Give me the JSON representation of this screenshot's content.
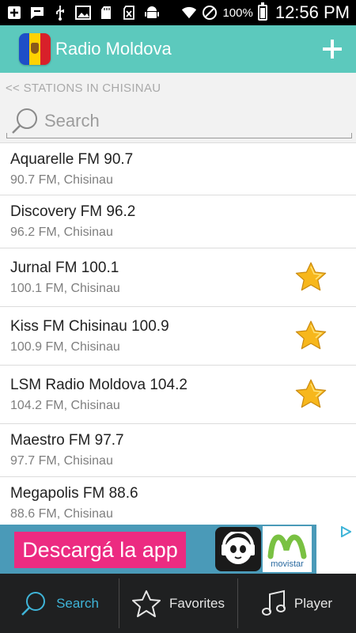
{
  "status_bar": {
    "battery_pct": "100%",
    "time": "12:56 PM",
    "icons": [
      "add-box-icon",
      "chat-icon",
      "usb-icon",
      "image-icon",
      "sd-card-icon",
      "no-sim-icon",
      "android-icon",
      "wifi-icon",
      "do-not-disturb-icon",
      "battery-icon"
    ]
  },
  "app_bar": {
    "title": "Radio Moldova",
    "flag": "moldova-flag-icon",
    "add_icon": "plus-icon",
    "color": "#5cc9bd"
  },
  "breadcrumb": "<< STATIONS IN CHISINAU",
  "search": {
    "placeholder": "Search"
  },
  "stations": [
    {
      "name": "Aquarelle FM 90.7",
      "sub": "90.7 FM, Chisinau",
      "favorite": false
    },
    {
      "name": "Discovery FM 96.2",
      "sub": "96.2 FM, Chisinau",
      "favorite": false
    },
    {
      "name": "Jurnal FM 100.1",
      "sub": "100.1 FM, Chisinau",
      "favorite": true
    },
    {
      "name": "Kiss FM Chisinau 100.9",
      "sub": "100.9 FM, Chisinau",
      "favorite": true
    },
    {
      "name": "LSM Radio Moldova 104.2",
      "sub": "104.2 FM, Chisinau",
      "favorite": true
    },
    {
      "name": "Maestro FM 97.7",
      "sub": "97.7 FM, Chisinau",
      "favorite": false
    },
    {
      "name": "Megapolis FM 88.6",
      "sub": "88.6 FM, Chisinau",
      "favorite": false
    }
  ],
  "ad": {
    "cta": "Descargá la app",
    "brand": "movistar",
    "choice_icon": "ad-choices-icon"
  },
  "bottom_nav": {
    "items": [
      {
        "label": "Search",
        "icon": "search-icon",
        "active": true
      },
      {
        "label": "Favorites",
        "icon": "star-outline-icon",
        "active": false
      },
      {
        "label": "Player",
        "icon": "music-note-icon",
        "active": false
      }
    ]
  }
}
